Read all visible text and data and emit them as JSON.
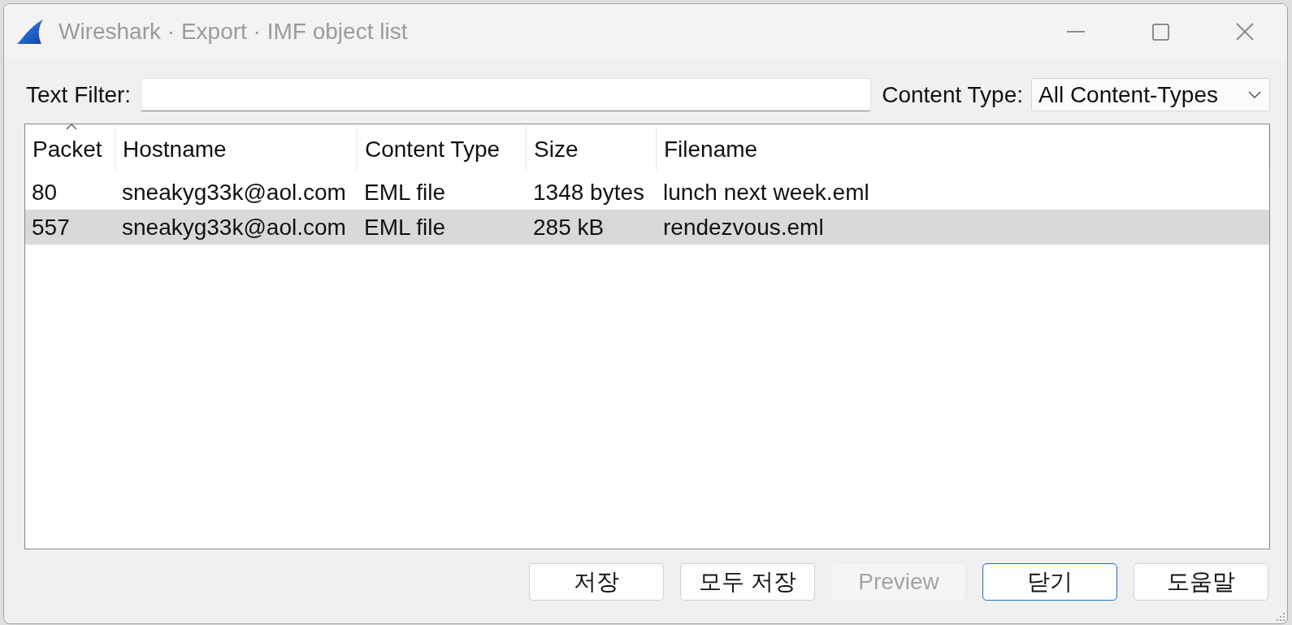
{
  "window": {
    "title": "Wireshark · Export · IMF object list"
  },
  "text_filter": {
    "label": "Text Filter:"
  },
  "content_type": {
    "label": "Content Type:",
    "value": "All Content-Types"
  },
  "table": {
    "columns": [
      {
        "label": "Packet",
        "sorted": true
      },
      {
        "label": "Hostname",
        "sorted": false
      },
      {
        "label": "Content Type",
        "sorted": false
      },
      {
        "label": "Size",
        "sorted": false
      },
      {
        "label": "Filename",
        "sorted": false
      }
    ],
    "rows": [
      {
        "cells": [
          "80",
          "sneakyg33k@aol.com",
          "EML file",
          "1348 bytes",
          "lunch next week.eml"
        ],
        "selected": false
      },
      {
        "cells": [
          "557",
          "sneakyg33k@aol.com",
          "EML file",
          "285 kB",
          "rendezvous.eml"
        ],
        "selected": true
      }
    ]
  },
  "buttons": [
    {
      "label": "저장",
      "disabled": false,
      "default": false
    },
    {
      "label": "모두 저장",
      "disabled": false,
      "default": false
    },
    {
      "label": "Preview",
      "disabled": true,
      "default": false
    },
    {
      "label": "닫기",
      "disabled": false,
      "default": true
    },
    {
      "label": "도움말",
      "disabled": false,
      "default": false
    }
  ]
}
